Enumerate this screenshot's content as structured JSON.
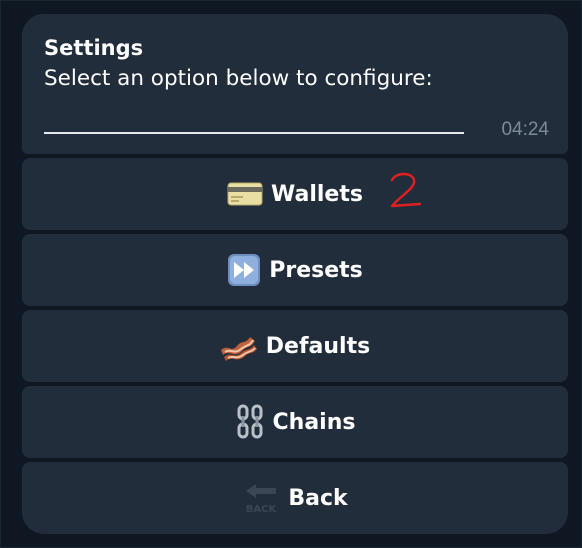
{
  "message": {
    "title": "Settings",
    "text": "Select an option below to configure:",
    "time": "04:24"
  },
  "buttons": [
    {
      "label": "Wallets",
      "icon": "credit-card-icon"
    },
    {
      "label": "Presets",
      "icon": "fast-forward-icon"
    },
    {
      "label": "Defaults",
      "icon": "bacon-icon"
    },
    {
      "label": "Chains",
      "icon": "chain-icon"
    },
    {
      "label": "Back",
      "icon": "back-arrow-icon"
    }
  ],
  "annotation": {
    "text": "2",
    "color": "#e02020"
  },
  "colors": {
    "background": "#0f1722",
    "bubble": "#222d3c",
    "text": "#ffffff",
    "timestamp": "#7c8a9c"
  }
}
